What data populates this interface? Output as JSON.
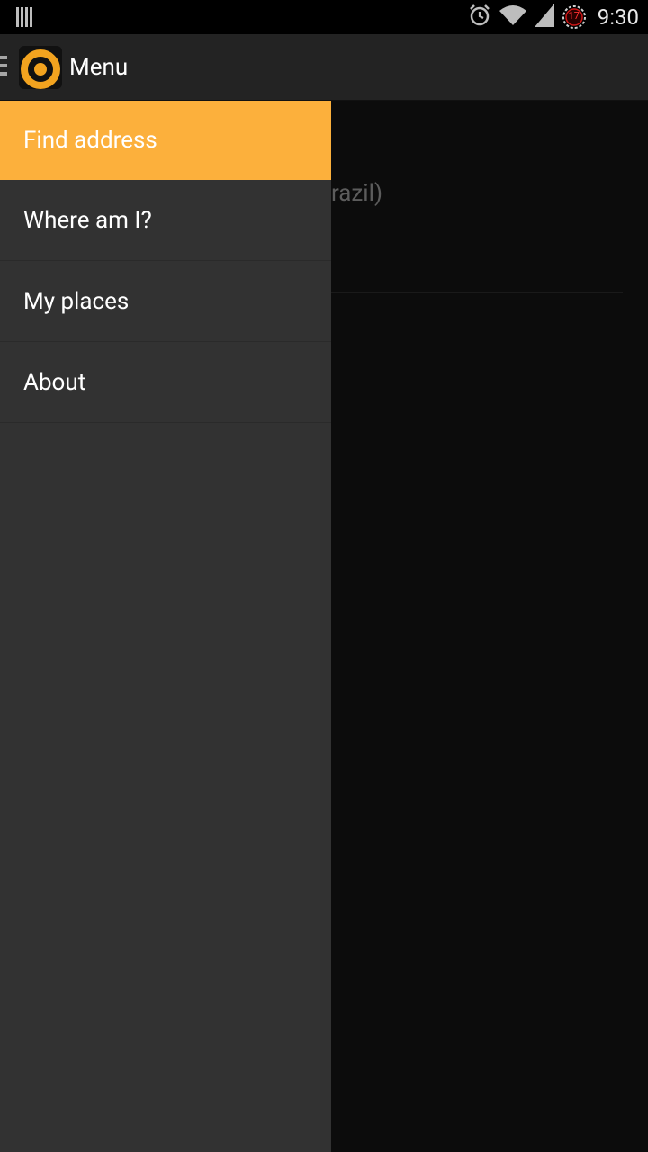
{
  "status_bar": {
    "time": "9:30",
    "calendar_badge": "17",
    "icons": [
      "notification-bars-icon",
      "alarm-icon",
      "wifi-icon",
      "signal-icon",
      "calendar-badge-icon"
    ]
  },
  "action_bar": {
    "title": "Menu",
    "logo": "app-logo-icon"
  },
  "background_content": {
    "partial_text": "razil)"
  },
  "drawer": {
    "items": [
      {
        "label": "Find address",
        "active": true
      },
      {
        "label": "Where am I?",
        "active": false
      },
      {
        "label": "My places",
        "active": false
      },
      {
        "label": "About",
        "active": false
      }
    ]
  },
  "colors": {
    "accent": "#fcb03c",
    "drawer_bg": "#323232",
    "action_bar_bg": "#232323",
    "status_bar_bg": "#000000"
  }
}
